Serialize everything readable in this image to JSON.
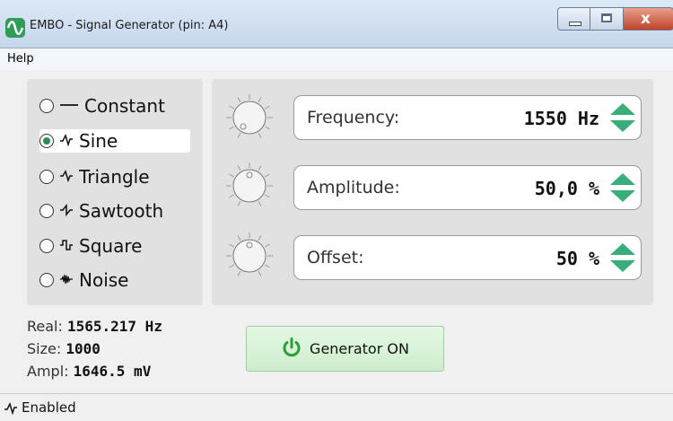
{
  "window": {
    "title": "EMBO - Signal Generator (pin: A4)",
    "icon": "sine-wave-app-icon",
    "accent": "#2f9d58",
    "close_glyph": "x"
  },
  "menu": {
    "help": "Help"
  },
  "waveforms": [
    {
      "label": "Constant",
      "icon": "constant-icon",
      "selected": false
    },
    {
      "label": "Sine",
      "icon": "sine-icon",
      "selected": true
    },
    {
      "label": "Triangle",
      "icon": "triangle-icon",
      "selected": false
    },
    {
      "label": "Sawtooth",
      "icon": "sawtooth-icon",
      "selected": false
    },
    {
      "label": "Square",
      "icon": "square-icon",
      "selected": false
    },
    {
      "label": "Noise",
      "icon": "noise-icon",
      "selected": false
    }
  ],
  "controls": {
    "frequency": {
      "label": "Frequency:",
      "value": "1550 Hz"
    },
    "amplitude": {
      "label": "Amplitude:",
      "value": "50,0 %"
    },
    "offset": {
      "label": "Offset:",
      "value": "50 %"
    }
  },
  "info": {
    "real_label": "Real:",
    "real_value": "1565.217 Hz",
    "size_label": "Size:",
    "size_value": "1000",
    "ampl_label": "Ampl:",
    "ampl_value": "1646.5 mV"
  },
  "generator_button": {
    "label": "Generator ON",
    "icon": "power-icon",
    "color": "#2e9d3a"
  },
  "status": {
    "text": "Enabled",
    "icon": "sine-icon"
  }
}
